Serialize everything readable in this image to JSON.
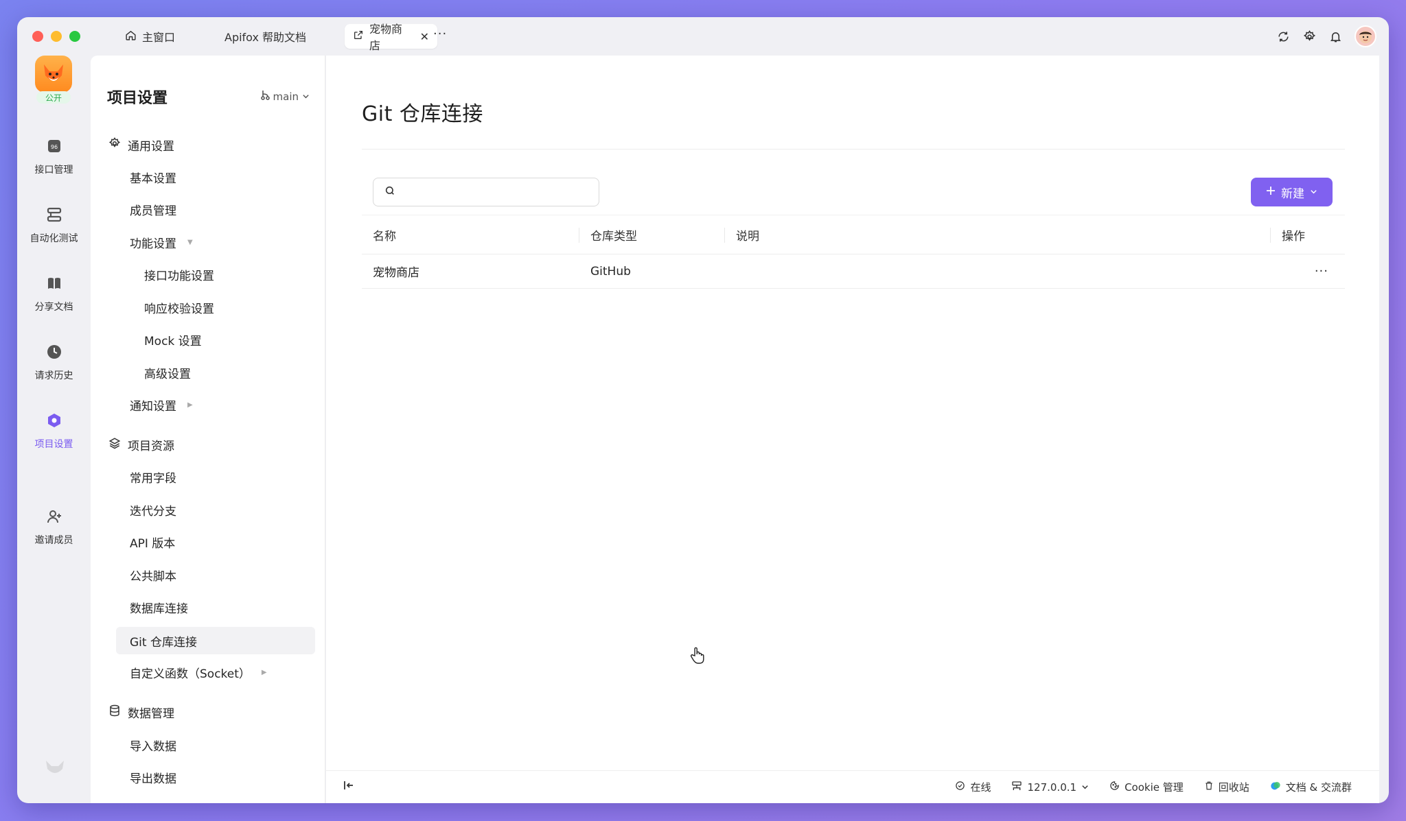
{
  "titlebar": {
    "tabs": [
      {
        "label": "主窗口",
        "icon": "home-icon"
      },
      {
        "label": "Apifox 帮助文档"
      },
      {
        "label": "宠物商店",
        "icon": "external-link-icon",
        "active": true
      }
    ],
    "more": "···"
  },
  "leftnav": {
    "badge": "公开",
    "items": [
      {
        "label": "接口管理",
        "icon": "api-icon"
      },
      {
        "label": "自动化测试",
        "icon": "automation-icon"
      },
      {
        "label": "分享文档",
        "icon": "book-icon"
      },
      {
        "label": "请求历史",
        "icon": "clock-icon"
      },
      {
        "label": "项目设置",
        "icon": "hexagon-settings-icon",
        "active": true
      },
      {
        "label": "邀请成员",
        "icon": "add-user-icon"
      }
    ]
  },
  "settings": {
    "title": "项目设置",
    "branch": "main",
    "groups": [
      {
        "label": "通用设置",
        "icon": "gear-icon"
      },
      {
        "label": "基本设置"
      },
      {
        "label": "成员管理"
      },
      {
        "label": "功能设置"
      },
      {
        "label": "接口功能设置"
      },
      {
        "label": "响应校验设置"
      },
      {
        "label": "Mock 设置"
      },
      {
        "label": "高级设置"
      },
      {
        "label": "通知设置"
      },
      {
        "label": "项目资源",
        "icon": "layers-icon"
      },
      {
        "label": "常用字段"
      },
      {
        "label": "迭代分支"
      },
      {
        "label": "API 版本"
      },
      {
        "label": "公共脚本"
      },
      {
        "label": "数据库连接"
      },
      {
        "label": "Git 仓库连接",
        "active": true
      },
      {
        "label": "自定义函数（Socket）"
      },
      {
        "label": "数据管理",
        "icon": "database-icon"
      },
      {
        "label": "导入数据"
      },
      {
        "label": "导出数据"
      }
    ]
  },
  "main": {
    "title": "Git 仓库连接",
    "search": {
      "value": "",
      "placeholder": ""
    },
    "new_button": "新建",
    "table": {
      "headers": [
        "名称",
        "仓库类型",
        "说明",
        "操作"
      ],
      "rows": [
        {
          "name": "宠物商店",
          "type": "GitHub",
          "desc": "",
          "action": "···"
        }
      ]
    }
  },
  "statusbar": {
    "online": "在线",
    "host": "127.0.0.1",
    "cookie": "Cookie 管理",
    "trash": "回收站",
    "docs": "文档 & 交流群"
  },
  "colors": {
    "accent": "#8061f0",
    "active_nav": "#7b5cf0",
    "public_badge": "#2eaa4f"
  }
}
